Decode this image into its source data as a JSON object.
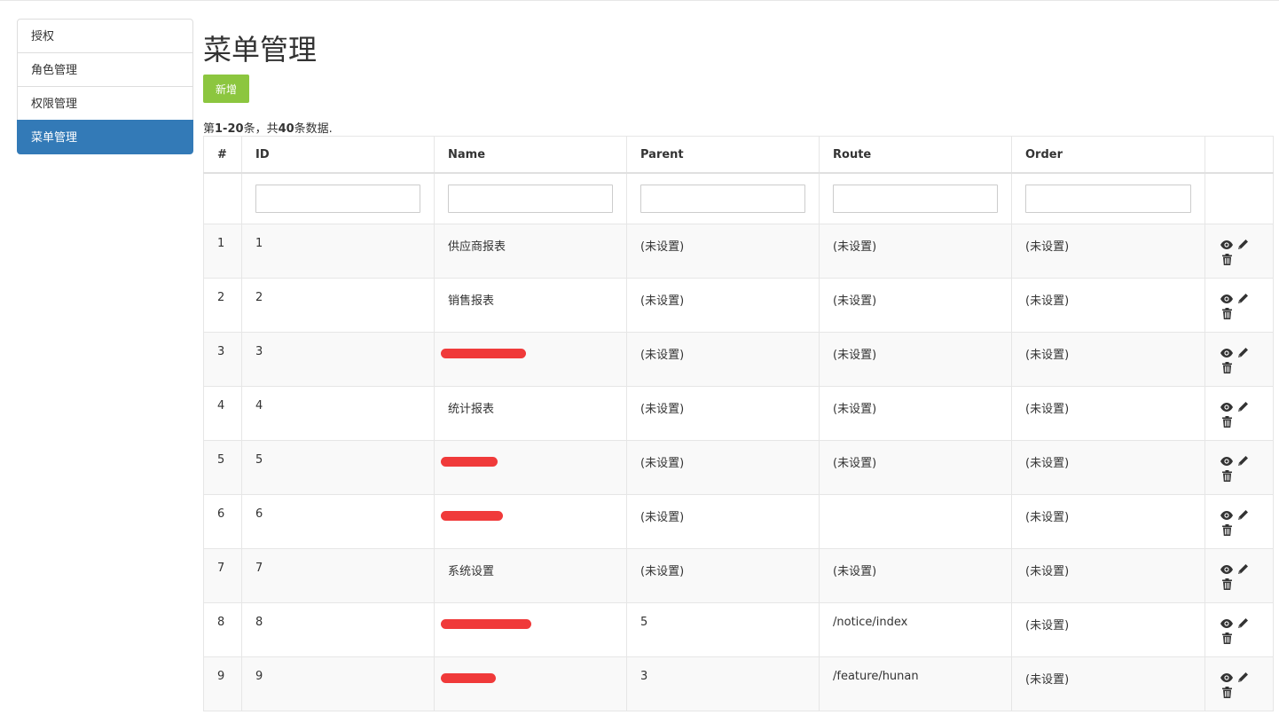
{
  "sidebar": {
    "items": [
      {
        "label": "授权",
        "active": false
      },
      {
        "label": "角色管理",
        "active": false
      },
      {
        "label": "权限管理",
        "active": false
      },
      {
        "label": "菜单管理",
        "active": true
      }
    ]
  },
  "page": {
    "title": "菜单管理",
    "add_button": "新增"
  },
  "summary": {
    "prefix": "第",
    "range": "1-20",
    "mid": "条，共",
    "total": "40",
    "suffix": "条数据."
  },
  "table": {
    "columns": [
      "#",
      "ID",
      "Name",
      "Parent",
      "Route",
      "Order",
      ""
    ],
    "rows": [
      {
        "num": "1",
        "id": "1",
        "name": "供应商报表",
        "name_redacted": false,
        "parent": "(未设置)",
        "route": "(未设置)",
        "order": "(未设置)"
      },
      {
        "num": "2",
        "id": "2",
        "name": "销售报表",
        "name_redacted": false,
        "parent": "(未设置)",
        "route": "(未设置)",
        "order": "(未设置)"
      },
      {
        "num": "3",
        "id": "3",
        "name": "",
        "name_redacted": true,
        "parent": "(未设置)",
        "route": "(未设置)",
        "order": "(未设置)"
      },
      {
        "num": "4",
        "id": "4",
        "name": "统计报表",
        "name_redacted": false,
        "parent": "(未设置)",
        "route": "(未设置)",
        "order": "(未设置)"
      },
      {
        "num": "5",
        "id": "5",
        "name": "",
        "name_redacted": true,
        "parent": "(未设置)",
        "route": "(未设置)",
        "order": "(未设置)"
      },
      {
        "num": "6",
        "id": "6",
        "name": "",
        "name_redacted": true,
        "parent": "(未设置)",
        "route": "",
        "order": "(未设置)"
      },
      {
        "num": "7",
        "id": "7",
        "name": "系统设置",
        "name_redacted": false,
        "parent": "(未设置)",
        "route": "(未设置)",
        "order": "(未设置)"
      },
      {
        "num": "8",
        "id": "8",
        "name": "",
        "name_redacted": true,
        "parent": "5",
        "route": "/notice/index",
        "order": "(未设置)"
      },
      {
        "num": "9",
        "id": "9",
        "name": "",
        "name_redacted": true,
        "parent": "3",
        "route": "/feature/hunan",
        "order": "(未设置)"
      }
    ],
    "row_actions": [
      "view-icon",
      "edit-icon",
      "delete-icon"
    ]
  },
  "colors": {
    "active_nav": "#337ab7",
    "add_button": "#8cc63f",
    "redaction": "#f03a3a"
  }
}
